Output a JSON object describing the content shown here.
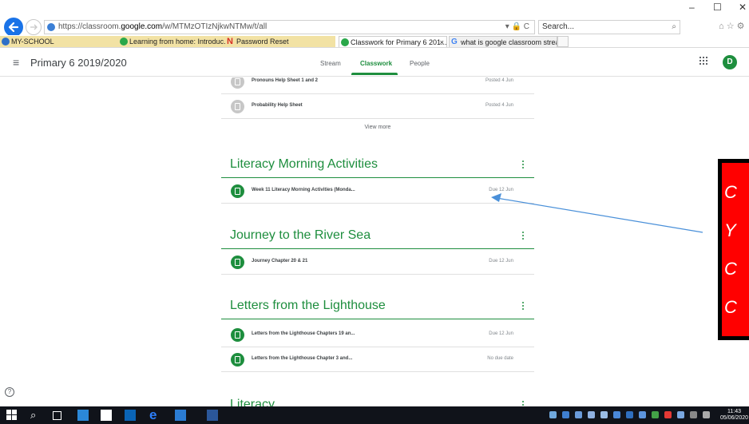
{
  "browser": {
    "url_prefix": "https://classroom.",
    "url_domain": "google.com",
    "url_suffix": "/w/MTMzOTIzNjkwNTMw/t/all",
    "url_tools": "▾ 🔒 C",
    "search_placeholder": "Search...",
    "favorites": [
      {
        "label": "MY-SCHOOL",
        "color": "#2e6fc7"
      },
      {
        "label": "Learning from home: Introduc...",
        "color": "#2aa84a"
      },
      {
        "label": "Password Reset",
        "color": "#d93025"
      }
    ],
    "tabs": [
      {
        "label": "Classwork for Primary 6 201...",
        "close": "×"
      },
      {
        "label": "what is google classroom strea...",
        "close": ""
      }
    ],
    "window_controls": {
      "minimize": "–",
      "maximize": "☐",
      "close": "✕"
    },
    "toolbar_icons": "⌂ ☆ ⚙"
  },
  "header": {
    "menu_icon": "≡",
    "class_title": "Primary 6 2019/2020",
    "tabs": [
      {
        "label": "Stream",
        "active": false
      },
      {
        "label": "Classwork",
        "active": true
      },
      {
        "label": "People",
        "active": false
      }
    ],
    "avatar_initial": "D"
  },
  "accent_color": "#1e8e3e",
  "items_top": [
    {
      "title": "Pronouns Help Sheet 1 and 2",
      "meta": "Posted 4 Jun",
      "icon": "material-icon"
    },
    {
      "title": "Probability Help Sheet",
      "meta": "Posted 4 Jun",
      "icon": "material-icon"
    }
  ],
  "view_more": "View more",
  "topics": [
    {
      "title": "Literacy Morning Activities",
      "items": [
        {
          "title": "Week 11 Literacy Morning Activities (Monda...",
          "meta": "Due 12 Jun",
          "icon": "assignment-icon"
        }
      ]
    },
    {
      "title": "Journey to the River Sea",
      "items": [
        {
          "title": "Journey Chapter 20 & 21",
          "meta": "Due 12 Jun",
          "icon": "assignment-icon"
        }
      ]
    },
    {
      "title": "Letters from the Lighthouse",
      "items": [
        {
          "title": "Letters from the Lighthouse Chapters 19 an...",
          "meta": "Due 12 Jun",
          "icon": "assignment-icon"
        },
        {
          "title": "Letters from the Lighthouse Chapter 3 and...",
          "meta": "No due date",
          "icon": "assignment-icon"
        }
      ]
    },
    {
      "title": "Literacy",
      "items": []
    }
  ],
  "annotation": {
    "letters": [
      "C",
      "Y",
      "C",
      "C"
    ],
    "box_color": "#ff0000",
    "arrow_color": "#4a90d9"
  },
  "help_icon": "?",
  "taskbar": {
    "time": "11:43",
    "date": "05/06/2020",
    "search_icon": "⌕"
  }
}
